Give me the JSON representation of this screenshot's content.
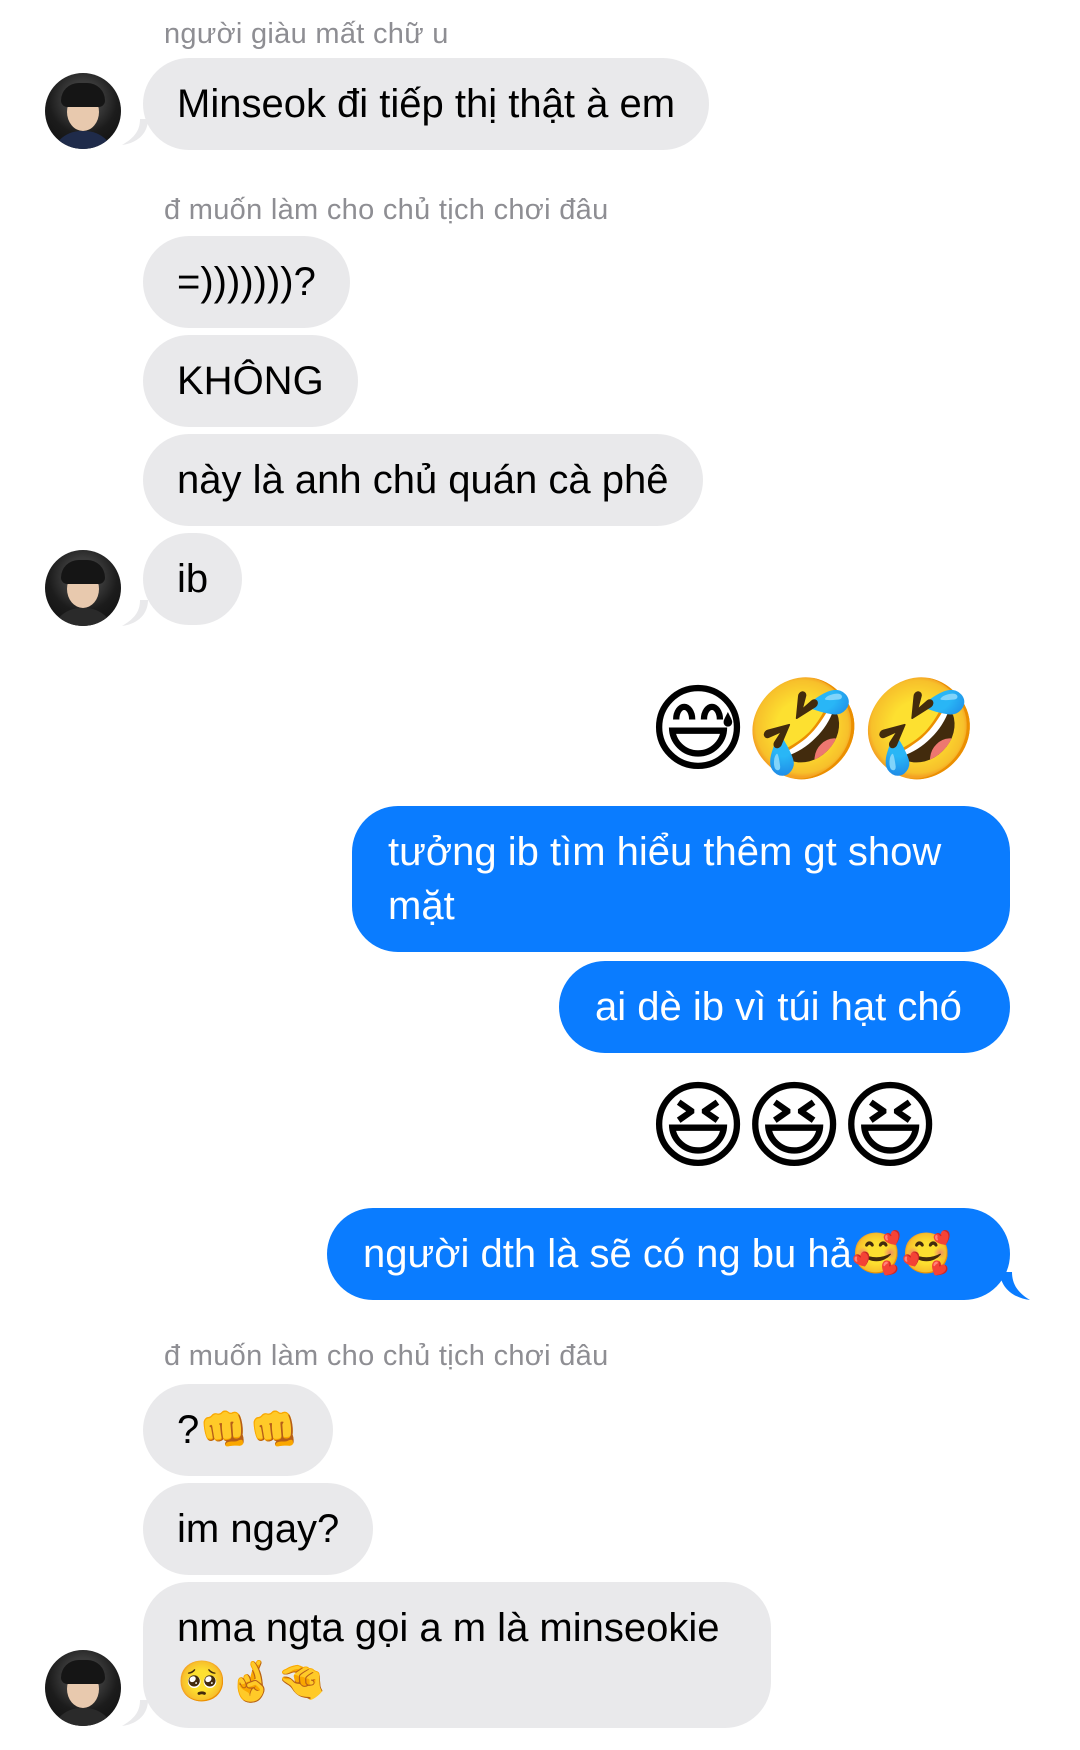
{
  "thread": {
    "sender_name_1": "người giàu mất chữ u",
    "sender_name_2": "đ muốn làm cho chủ tịch chơi đâu",
    "sender_name_3": "đ muốn làm cho chủ tịch chơi đâu",
    "messages": [
      {
        "text": "Minseok đi tiếp thị thật à em"
      },
      {
        "text": "=)))))))?"
      },
      {
        "text": "KHÔNG"
      },
      {
        "text": "này là anh chủ quán cà phê"
      },
      {
        "text": "ib"
      },
      {
        "text": "😅🤣🤣"
      },
      {
        "line1": "tưởng ib tìm hiểu thêm gt show",
        "line2": "mặt"
      },
      {
        "text": "ai dè ib vì túi hạt chó"
      },
      {
        "text": "😆😆😆"
      },
      {
        "text": "người dth là sẽ có ng bu hả🥰🥰"
      },
      {
        "text": "?👊👊"
      },
      {
        "text": "im ngay?"
      },
      {
        "line1": "nma ngta gọi a m là minseokie",
        "line2": "🥺🤞🤏"
      }
    ]
  }
}
